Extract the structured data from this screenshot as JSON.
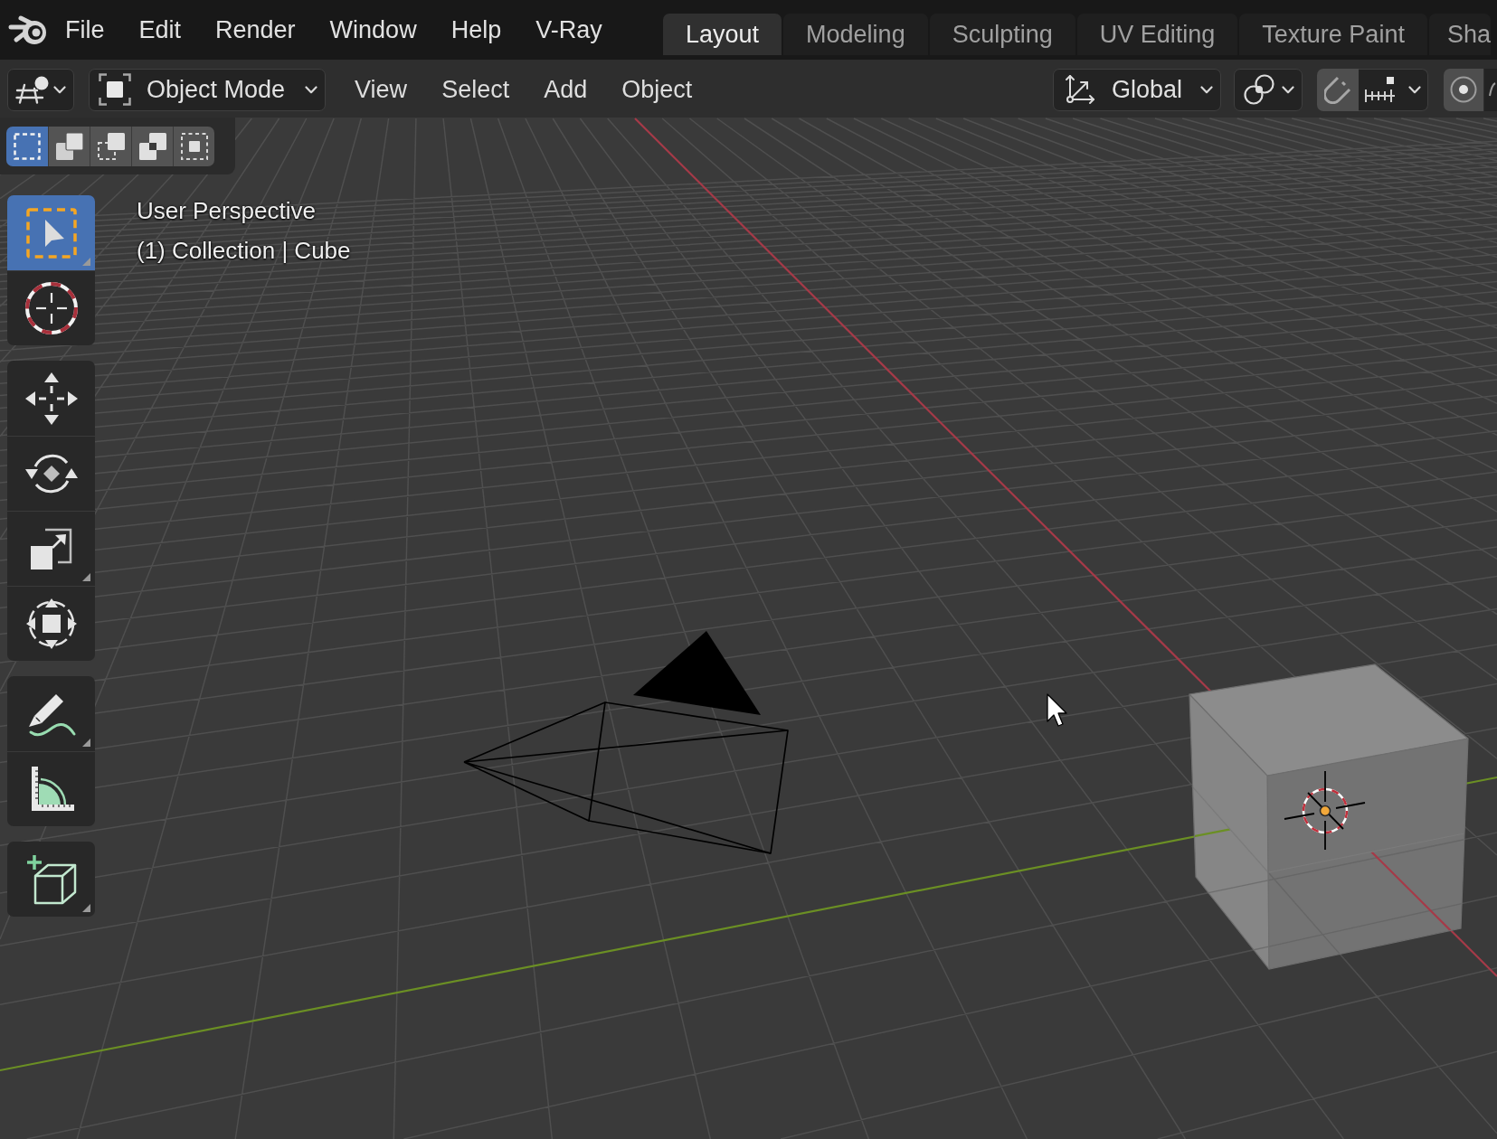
{
  "menu_bar": {
    "items": [
      "File",
      "Edit",
      "Render",
      "Window",
      "Help",
      "V-Ray"
    ]
  },
  "workspace_tabs": [
    {
      "label": "Layout",
      "selected": true
    },
    {
      "label": "Modeling",
      "selected": false
    },
    {
      "label": "Sculpting",
      "selected": false
    },
    {
      "label": "UV Editing",
      "selected": false
    },
    {
      "label": "Texture Paint",
      "selected": false
    },
    {
      "label": "Sha",
      "selected": false
    }
  ],
  "header": {
    "mode": "Object Mode",
    "menus": [
      "View",
      "Select",
      "Add",
      "Object"
    ],
    "orientation": "Global"
  },
  "select_modes": [
    {
      "selected": true
    },
    {
      "selected": false
    },
    {
      "selected": false
    },
    {
      "selected": false
    },
    {
      "selected": false
    }
  ],
  "toolbar": [
    {
      "tools": [
        {
          "selected": true,
          "more": true
        },
        {
          "selected": false,
          "more": false
        }
      ]
    },
    {
      "tools": [
        {
          "selected": false,
          "more": false
        },
        {
          "selected": false,
          "more": false
        },
        {
          "selected": false,
          "more": true
        },
        {
          "selected": false,
          "more": false
        }
      ]
    },
    {
      "tools": [
        {
          "selected": false,
          "more": true
        },
        {
          "selected": false,
          "more": false
        }
      ]
    },
    {
      "tools": [
        {
          "selected": false,
          "more": true
        }
      ]
    }
  ],
  "viewport": {
    "view_name": "User Perspective",
    "context": "(1) Collection | Cube"
  }
}
